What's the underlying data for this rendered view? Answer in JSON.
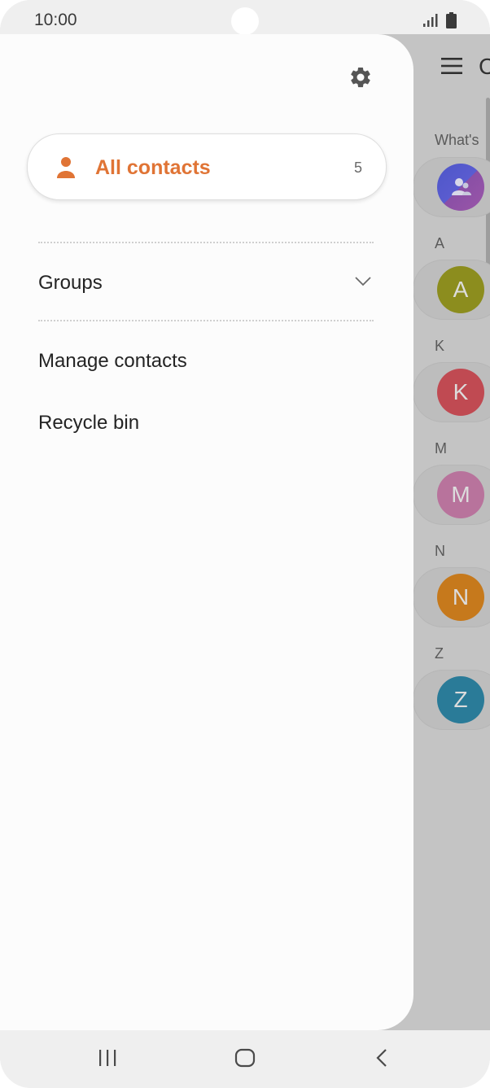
{
  "status_bar": {
    "time": "10:00",
    "icons": [
      "signal-icon",
      "battery-icon"
    ]
  },
  "drawer": {
    "settings_icon": "gear-icon",
    "all_contacts": {
      "label": "All contacts",
      "count": "5",
      "icon": "person-icon",
      "accent_color": "#e07435"
    },
    "groups_label": "Groups",
    "manage_contacts_label": "Manage contacts",
    "recycle_bin_label": "Recycle bin"
  },
  "background_list": {
    "title_initial": "C",
    "whats_new_label": "What's",
    "sections": [
      {
        "letter": "A",
        "initial": "A",
        "color": "#8c8d1e"
      },
      {
        "letter": "K",
        "initial": "K",
        "color": "#c04a52"
      },
      {
        "letter": "M",
        "initial": "M",
        "color": "#b8739c"
      },
      {
        "letter": "N",
        "initial": "N",
        "color": "#c6791c"
      },
      {
        "letter": "Z",
        "initial": "Z",
        "color": "#2a7b98"
      }
    ]
  },
  "nav_bar": {
    "buttons": [
      "recent-apps-icon",
      "home-icon",
      "back-icon"
    ]
  }
}
